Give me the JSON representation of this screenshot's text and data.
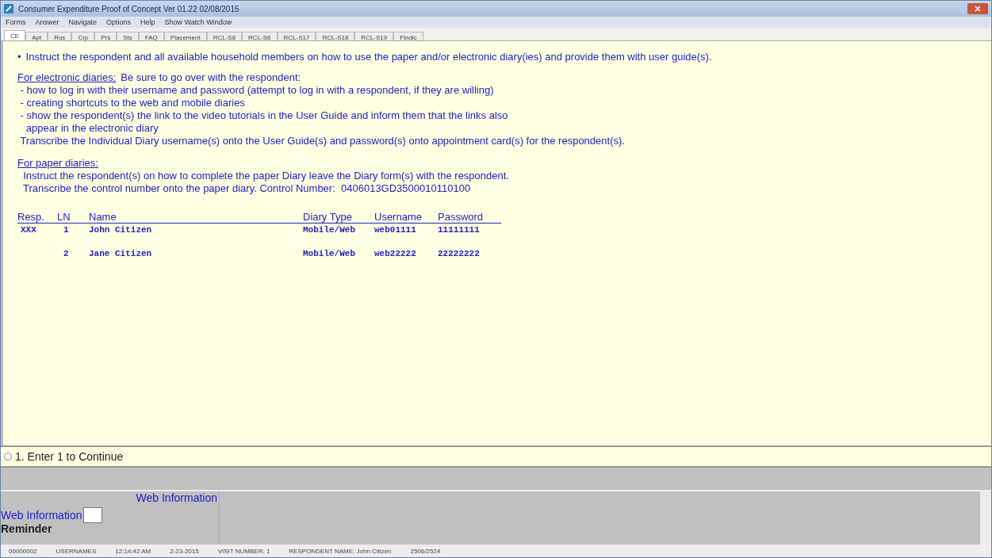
{
  "window": {
    "title": "Consumer Expenditure Proof of Concept Ver 01.22 02/08/2015"
  },
  "menu": [
    "Forms",
    "Answer",
    "Navigate",
    "Options",
    "Help",
    "Show Watch Window"
  ],
  "tabs": [
    {
      "label": "CE",
      "selected": true
    },
    {
      "label": "Apt",
      "selected": false
    },
    {
      "label": "Ros",
      "selected": false
    },
    {
      "label": "Crp",
      "selected": false
    },
    {
      "label": "Prs",
      "selected": false
    },
    {
      "label": "Sts",
      "selected": false
    },
    {
      "label": "FAQ",
      "selected": false
    },
    {
      "label": "Placement",
      "selected": false
    },
    {
      "label": "RCL-S8",
      "selected": false
    },
    {
      "label": "RCL-S6",
      "selected": false
    },
    {
      "label": "RCL-S17",
      "selected": false
    },
    {
      "label": "RCL-S18",
      "selected": false
    },
    {
      "label": "RCL-S19",
      "selected": false
    },
    {
      "label": "Findic",
      "selected": false
    }
  ],
  "question": {
    "bullet": "•",
    "intro": "Instruct the respondent and all available household members on how to use the paper and/or electronic diary(ies) and provide them with user guide(s).",
    "electronic_heading": "For electronic diaries:",
    "electronic_lead": "Be sure to go over with the respondent:",
    "electronic_lines": [
      "- how to log in with their username and password (attempt to log in with a respondent, if they are willing)",
      "- creating shortcuts to the web and mobile diaries",
      "- show the respondent(s) the link to the video tutorials in the User Guide and inform them that the links also",
      "  appear in the electronic diary",
      "Transcribe the Individual Diary username(s) onto the User Guide(s) and password(s) onto appointment card(s) for the respondent(s)."
    ],
    "paper_heading": "For paper diaries:",
    "paper_lines": [
      "Instruct the respondent(s) on how to complete the paper Diary leave the Diary form(s) with the respondent.",
      "Transcribe the control number onto the paper diary. Control Number:  0406013GD3500010110100"
    ]
  },
  "table": {
    "columns": [
      "Resp.",
      "LN",
      "Name",
      "Diary Type",
      "Username",
      "Password"
    ],
    "rows": [
      [
        "XXX",
        "1",
        "John Citizen",
        "Mobile/Web",
        "web01111",
        "11111111"
      ],
      [
        "",
        "2",
        "Jane Citizen",
        "Mobile/Web",
        "web22222",
        "22222222"
      ]
    ]
  },
  "answer": {
    "label": "1. Enter 1 to Continue",
    "selected": false
  },
  "bottom_panel": {
    "header": "Web Information",
    "field_label": "Web Information",
    "next_label": "Reminder"
  },
  "status_bar": [
    "00000002",
    "USERNAMES",
    "12:14:42 AM",
    "2-23-2015",
    "VISIT NUMBER: 1",
    "RESPONDENT NAME: John Citizen",
    "2506/2524"
  ]
}
